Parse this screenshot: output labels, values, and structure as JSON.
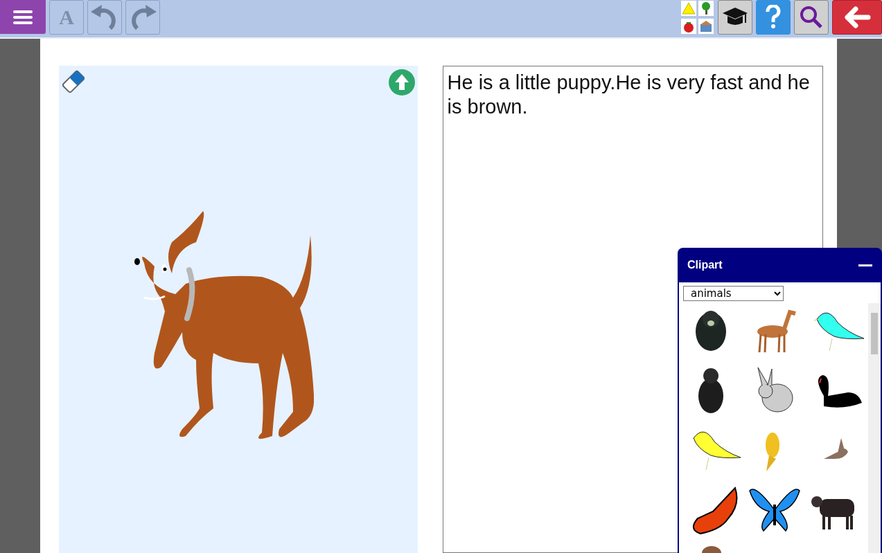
{
  "toolbar": {
    "font_button": "A"
  },
  "story": {
    "text": "He is a little puppy.He is very fast and he is brown."
  },
  "clipart": {
    "title": "Clipart",
    "category": "animals"
  }
}
